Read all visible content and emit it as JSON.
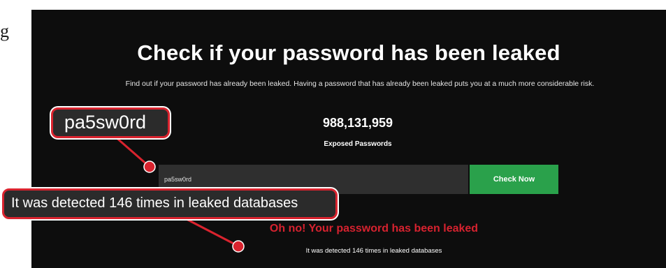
{
  "edge_fragment": "g",
  "page": {
    "title": "Check if your password has been leaked",
    "subtitle": "Find out if your password has already been leaked. Having a password that has already been leaked puts you at a much more considerable risk.",
    "exposed_count": "988,131,959",
    "exposed_label": "Exposed Passwords",
    "input_value": "pa5sw0rd",
    "check_button_label": "Check Now",
    "result_title": "Oh no! Your password has been leaked",
    "result_detail": "It was detected 146 times in leaked databases"
  },
  "annotations": {
    "password_callout": "pa5sw0rd",
    "detection_callout": "It was detected 146 times in leaked databases"
  },
  "colors": {
    "panel_bg": "#0d0d0d",
    "button_green": "#2aa14b",
    "alert_red": "#d6222f",
    "callout_border": "#d9232e"
  }
}
